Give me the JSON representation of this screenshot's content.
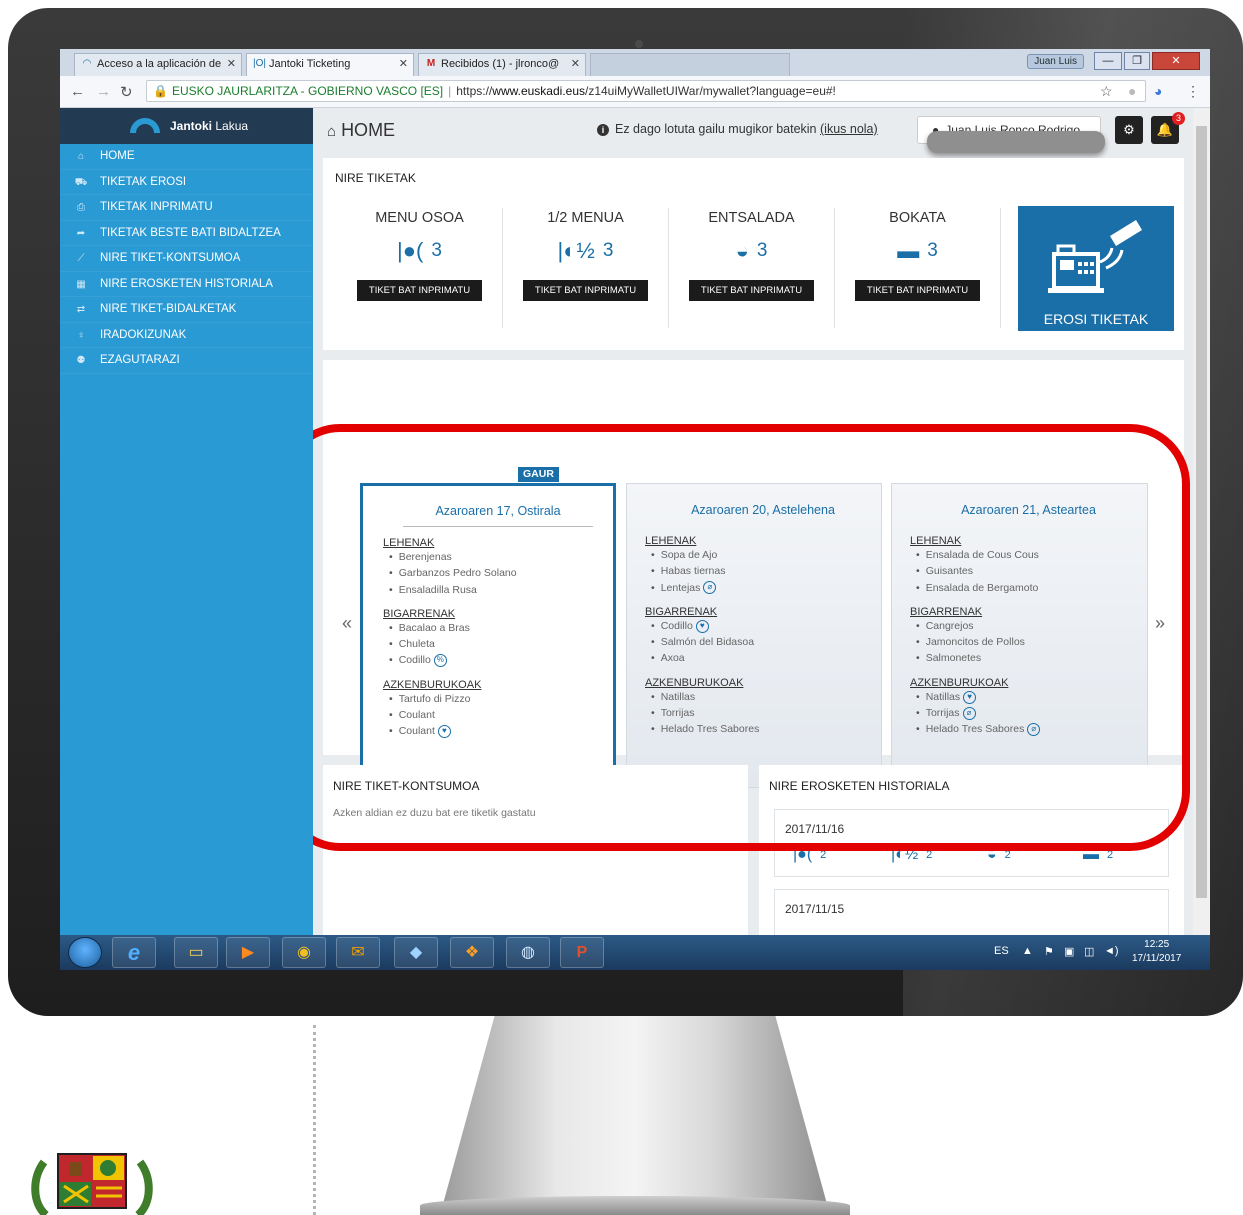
{
  "browser": {
    "tabs": [
      {
        "label": "Acceso a la aplicación de",
        "icon": "app-icon"
      },
      {
        "label": "Jantoki Ticketing",
        "icon": "jantoki-icon"
      },
      {
        "label": "Recibidos (1) - jlronco@",
        "icon": "gmail-icon"
      },
      {
        "label": "",
        "icon": "blank-tab-icon"
      }
    ],
    "window_user": "Juan Luis",
    "address": {
      "site_name": "EUSKO JAURLARITZA - GOBIERNO VASCO [ES]",
      "url_prefix": "https://",
      "url_host": "www.euskadi.eus",
      "url_path": "/z14uiMyWalletUIWar/mywallet?language=eu#!"
    }
  },
  "sidebar": {
    "brand_bold": "Jantoki",
    "brand_rest": " Lakua",
    "items": [
      {
        "label": "HOME",
        "icon": "home-icon"
      },
      {
        "label": "TIKETAK EROSI",
        "icon": "cart-icon"
      },
      {
        "label": "TIKETAK INPRIMATU",
        "icon": "print-icon"
      },
      {
        "label": "TIKETAK BESTE BATI BIDALTZEA",
        "icon": "share-icon"
      },
      {
        "label": "NIRE TIKET-KONTSUMOA",
        "icon": "chart-icon"
      },
      {
        "label": "NIRE EROSKETEN HISTORIALA",
        "icon": "calculator-icon"
      },
      {
        "label": "NIRE TIKET-BIDALKETAK",
        "icon": "transfer-icon"
      },
      {
        "label": "IRADOKIZUNAK",
        "icon": "lightbulb-icon"
      },
      {
        "label": "EZAGUTARAZI",
        "icon": "add-user-icon"
      }
    ]
  },
  "header": {
    "title": "HOME",
    "warning_text": "Ez dago lotuta gailu mugikor batekin",
    "warning_link": "(ikus nola)",
    "user_name": "Juan Luis Ronco Rodrigo",
    "notification_count": "3"
  },
  "tickets": {
    "title": "NIRE TIKETAK",
    "items": [
      {
        "name": "MENU OSOA",
        "count": "3",
        "button": "TIKET BAT INPRIMATU",
        "icon": "full-menu-icon"
      },
      {
        "name": "1/2 MENUA",
        "count": "3",
        "button": "TIKET BAT INPRIMATU",
        "icon": "half-menu-icon"
      },
      {
        "name": "ENTSALADA",
        "count": "3",
        "button": "TIKET BAT INPRIMATU",
        "icon": "salad-icon"
      },
      {
        "name": "BOKATA",
        "count": "3",
        "button": "TIKET BAT INPRIMATU",
        "icon": "sandwich-icon"
      }
    ],
    "buy_label": "EROSI TIKETAK"
  },
  "menu": {
    "today_badge": "GAUR",
    "days": [
      {
        "title": "Azaroaren 17, Ostirala",
        "courses": [
          {
            "name": "LEHENAK",
            "dishes": [
              {
                "name": "Berenjenas",
                "icon": ""
              },
              {
                "name": "Garbanzos Pedro Solano",
                "icon": ""
              },
              {
                "name": "Ensaladilla Rusa",
                "icon": ""
              }
            ]
          },
          {
            "name": "BIGARRENAK",
            "dishes": [
              {
                "name": "Bacalao a Bras",
                "icon": ""
              },
              {
                "name": "Chuleta",
                "icon": ""
              },
              {
                "name": "Codillo",
                "icon": "percent"
              }
            ]
          },
          {
            "name": "AZKENBURUKOAK",
            "dishes": [
              {
                "name": "Tartufo di Pizzo",
                "icon": ""
              },
              {
                "name": "Coulant",
                "icon": ""
              },
              {
                "name": "Coulant",
                "icon": "heart"
              }
            ]
          }
        ]
      },
      {
        "title": "Azaroaren 20, Astelehena",
        "courses": [
          {
            "name": "LEHENAK",
            "dishes": [
              {
                "name": "Sopa de Ajo",
                "icon": ""
              },
              {
                "name": "Habas tiernas",
                "icon": ""
              },
              {
                "name": "Lentejas",
                "icon": "leaf"
              }
            ]
          },
          {
            "name": "BIGARRENAK",
            "dishes": [
              {
                "name": "Codillo",
                "icon": "heart"
              },
              {
                "name": "Salmón del Bidasoa",
                "icon": ""
              },
              {
                "name": "Axoa",
                "icon": ""
              }
            ]
          },
          {
            "name": "AZKENBURUKOAK",
            "dishes": [
              {
                "name": "Natillas",
                "icon": ""
              },
              {
                "name": "Torrijas",
                "icon": ""
              },
              {
                "name": "Helado Tres Sabores",
                "icon": ""
              }
            ]
          }
        ]
      },
      {
        "title": "Azaroaren 21, Asteartea",
        "courses": [
          {
            "name": "LEHENAK",
            "dishes": [
              {
                "name": "Ensalada de Cous Cous",
                "icon": ""
              },
              {
                "name": "Guisantes",
                "icon": ""
              },
              {
                "name": "Ensalada de Bergamoto",
                "icon": ""
              }
            ]
          },
          {
            "name": "BIGARRENAK",
            "dishes": [
              {
                "name": "Cangrejos",
                "icon": ""
              },
              {
                "name": "Jamoncitos de Pollos",
                "icon": ""
              },
              {
                "name": "Salmonetes",
                "icon": ""
              }
            ]
          },
          {
            "name": "AZKENBURUKOAK",
            "dishes": [
              {
                "name": "Natillas",
                "icon": "heart"
              },
              {
                "name": "Torrijas",
                "icon": "leaf"
              },
              {
                "name": "Helado Tres Sabores",
                "icon": "leaf"
              }
            ]
          }
        ]
      }
    ]
  },
  "consumption": {
    "title": "NIRE TIKET-KONTSUMOA",
    "empty_text": "Azken aldian ez duzu bat ere tiketik gastatu"
  },
  "history": {
    "title": "NIRE EROSKETEN HISTORIALA",
    "entries": [
      {
        "date": "2017/11/16",
        "counts": [
          "2",
          "2",
          "2",
          "2"
        ]
      },
      {
        "date": "2017/11/15",
        "counts": []
      }
    ]
  },
  "taskbar": {
    "lang": "ES",
    "time": "12:25",
    "date": "17/11/2017"
  },
  "colors": {
    "sidebar": "#2a9ad4",
    "sidebar_header": "#233b52",
    "accent": "#1a6fa8",
    "highlight_frame": "#e30000"
  }
}
